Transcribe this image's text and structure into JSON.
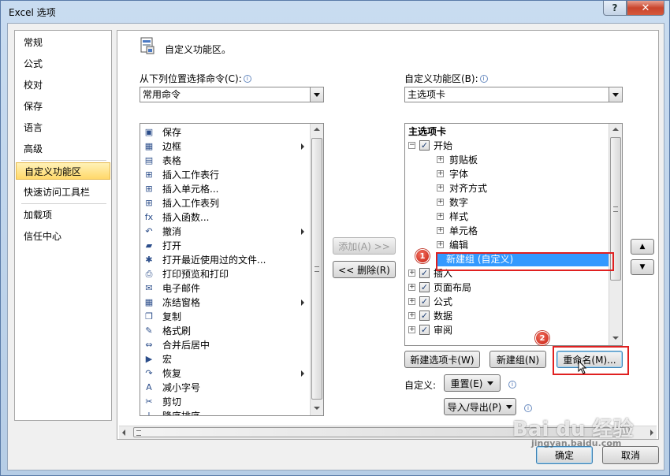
{
  "window": {
    "title": "Excel 选项",
    "help_label": "?",
    "close_label": "✕"
  },
  "nav": {
    "items": [
      {
        "label": "常规",
        "selected": false
      },
      {
        "label": "公式",
        "selected": false
      },
      {
        "label": "校对",
        "selected": false
      },
      {
        "label": "保存",
        "selected": false
      },
      {
        "label": "语言",
        "selected": false
      },
      {
        "label": "高级",
        "selected": false
      },
      {
        "label": "自定义功能区",
        "selected": true
      },
      {
        "label": "快速访问工具栏",
        "selected": false
      },
      {
        "label": "加载项",
        "selected": false
      },
      {
        "label": "信任中心",
        "selected": false
      }
    ]
  },
  "header": {
    "title": "自定义功能区。"
  },
  "left": {
    "label": "从下列位置选择命令(C):",
    "combo_value": "常用命令",
    "commands": [
      {
        "label": "保存",
        "icon": "save-icon",
        "glyph": "▣",
        "submenu": false
      },
      {
        "label": "边框",
        "icon": "border-icon",
        "glyph": "▦",
        "submenu": true
      },
      {
        "label": "表格",
        "icon": "table-icon",
        "glyph": "▤",
        "submenu": false
      },
      {
        "label": "插入工作表行",
        "icon": "insert-row-icon",
        "glyph": "⊞",
        "submenu": false
      },
      {
        "label": "插入单元格...",
        "icon": "insert-cell-icon",
        "glyph": "⊞",
        "submenu": false
      },
      {
        "label": "插入工作表列",
        "icon": "insert-column-icon",
        "glyph": "⊞",
        "submenu": false
      },
      {
        "label": "插入函数...",
        "icon": "function-icon",
        "glyph": "fx",
        "submenu": false
      },
      {
        "label": "撤消",
        "icon": "undo-icon",
        "glyph": "↶",
        "submenu": true
      },
      {
        "label": "打开",
        "icon": "open-folder-icon",
        "glyph": "▰",
        "submenu": false
      },
      {
        "label": "打开最近使用过的文件...",
        "icon": "recent-files-icon",
        "glyph": "✱",
        "submenu": false
      },
      {
        "label": "打印预览和打印",
        "icon": "print-preview-icon",
        "glyph": "⎙",
        "submenu": false
      },
      {
        "label": "电子邮件",
        "icon": "email-icon",
        "glyph": "✉",
        "submenu": false
      },
      {
        "label": "冻结窗格",
        "icon": "freeze-panes-icon",
        "glyph": "▦",
        "submenu": true
      },
      {
        "label": "复制",
        "icon": "copy-icon",
        "glyph": "❐",
        "submenu": false
      },
      {
        "label": "格式刷",
        "icon": "format-painter-icon",
        "glyph": "✎",
        "submenu": false
      },
      {
        "label": "合并后居中",
        "icon": "merge-center-icon",
        "glyph": "⇔",
        "submenu": false
      },
      {
        "label": "宏",
        "icon": "macro-icon",
        "glyph": "▶",
        "submenu": false
      },
      {
        "label": "恢复",
        "icon": "redo-icon",
        "glyph": "↷",
        "submenu": true
      },
      {
        "label": "减小字号",
        "icon": "decrease-font-icon",
        "glyph": "A",
        "submenu": false
      },
      {
        "label": "剪切",
        "icon": "cut-icon",
        "glyph": "✂",
        "submenu": false
      },
      {
        "label": "降序排序",
        "icon": "sort-desc-icon",
        "glyph": "↓",
        "submenu": false
      }
    ]
  },
  "middle": {
    "add_label": "添加(A) >>",
    "remove_label": "<< 删除(R)"
  },
  "right": {
    "label": "自定义功能区(B):",
    "combo_value": "主选项卡",
    "tree_header": "主选项卡",
    "tree": [
      {
        "label": "开始",
        "level": 0,
        "expander": "⊟",
        "checkbox": true
      },
      {
        "label": "剪贴板",
        "level": 1,
        "expander": "⊞",
        "checkbox": false
      },
      {
        "label": "字体",
        "level": 1,
        "expander": "⊞",
        "checkbox": false
      },
      {
        "label": "对齐方式",
        "level": 1,
        "expander": "⊞",
        "checkbox": false
      },
      {
        "label": "数字",
        "level": 1,
        "expander": "⊞",
        "checkbox": false
      },
      {
        "label": "样式",
        "level": 1,
        "expander": "⊞",
        "checkbox": false
      },
      {
        "label": "单元格",
        "level": 1,
        "expander": "⊞",
        "checkbox": false
      },
      {
        "label": "编辑",
        "level": 1,
        "expander": "⊞",
        "checkbox": false
      },
      {
        "label": "新建组 (自定义)",
        "level": 1,
        "expander": "",
        "checkbox": false,
        "selected": true
      },
      {
        "label": "插入",
        "level": 0,
        "expander": "⊞",
        "checkbox": true
      },
      {
        "label": "页面布局",
        "level": 0,
        "expander": "⊞",
        "checkbox": true
      },
      {
        "label": "公式",
        "level": 0,
        "expander": "⊞",
        "checkbox": true
      },
      {
        "label": "数据",
        "level": 0,
        "expander": "⊞",
        "checkbox": true
      },
      {
        "label": "审阅",
        "level": 0,
        "expander": "⊞",
        "checkbox": true
      }
    ],
    "new_tab_label": "新建选项卡(W)",
    "new_group_label": "新建组(N)",
    "rename_label": "重命名(M)...",
    "customize_label": "自定义:",
    "reset_label": "重置(E)",
    "import_export_label": "导入/导出(P)",
    "up_label": "▲",
    "down_label": "▼"
  },
  "annotations": {
    "step1": "1",
    "step2": "2"
  },
  "footer": {
    "ok_label": "确定",
    "cancel_label": "取消"
  },
  "watermark": {
    "logo": "Bai du 经验",
    "url": "jingyan.baidu.com"
  }
}
